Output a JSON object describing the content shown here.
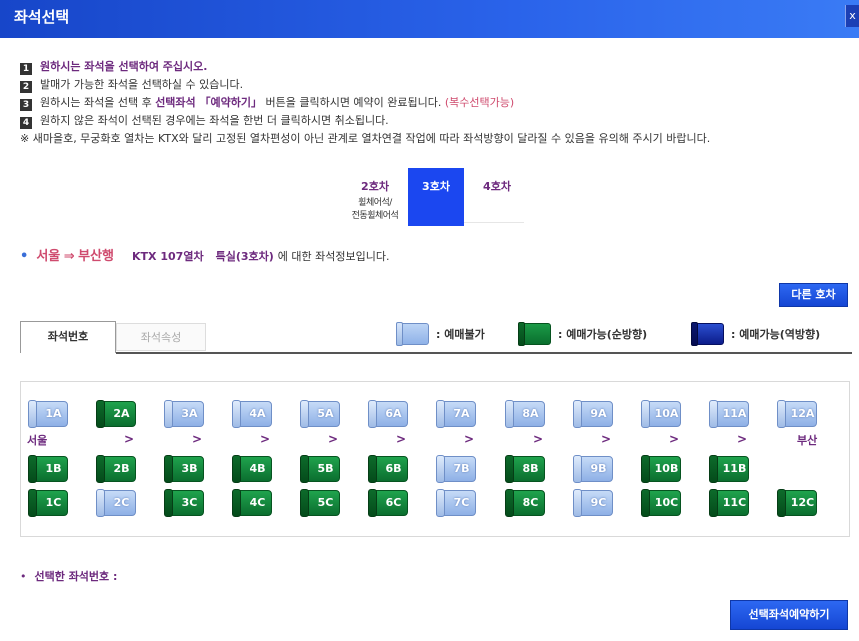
{
  "window": {
    "title": "좌석선택",
    "close_label": "x"
  },
  "instructions": [
    {
      "num": "1",
      "text": "원하시는 좌석을 선택하여 주십시오.",
      "style": "purple"
    },
    {
      "num": "2",
      "text": "발매가 가능한 좌석을 선택하실 수 있습니다.",
      "style": "plain"
    },
    {
      "num": "3",
      "text_a": "원하시는 좌석을 선택 후 ",
      "text_b": "선택좌석 「예약하기」",
      "text_c": " 버튼을 클릭하시면 예약이 완료됩니다. ",
      "text_d": "(복수선택가능)"
    },
    {
      "num": "4",
      "text": "원하지 않은 좌석이 선택된 경우에는 좌석을 한번 더 클릭하시면 취소됩니다.",
      "style": "plain"
    }
  ],
  "warning": "※ 새마을호, 무궁화호 열차는 KTX와 달리 고정된 열차편성이 아닌 관계로 열차연결 작업에 따라 좌석방향이 달라질 수 있음을 유의해 주시기 바랍니다.",
  "car_tabs": [
    {
      "label": "2호차",
      "sub1": "휠체어석/",
      "sub2": "전동휠체어석",
      "active": false
    },
    {
      "label": "3호차",
      "active": true
    },
    {
      "label": "4호차",
      "active": false
    }
  ],
  "route": {
    "bullet": "•",
    "from": "서울",
    "arrow": "⇒",
    "to": "부산행",
    "train": "KTX 107열차",
    "car_class": "특실(3호차)",
    "suffix": "에 대한 좌석정보입니다."
  },
  "next_car_button": "다른 호차",
  "info_tabs": [
    {
      "label": "좌석번호",
      "active": true
    },
    {
      "label": "좌석속성",
      "active": false
    }
  ],
  "legend": [
    {
      "icon": "seat-unavailable-icon",
      "color": "#9ebbe6",
      "label": ": 예매불가"
    },
    {
      "icon": "seat-forward-icon",
      "color": "#0b6e2f",
      "label": ": 예매가능(순방향)"
    },
    {
      "icon": "seat-reverse-icon",
      "color": "#0c1c8a",
      "label": ": 예매가능(역방향)"
    }
  ],
  "seat_rows": [
    {
      "row": "A",
      "seats": [
        {
          "id": "1A",
          "status": "unavailable"
        },
        {
          "id": "2A",
          "status": "available"
        },
        {
          "id": "3A",
          "status": "unavailable"
        },
        {
          "id": "4A",
          "status": "unavailable"
        },
        {
          "id": "5A",
          "status": "unavailable"
        },
        {
          "id": "6A",
          "status": "unavailable"
        },
        {
          "id": "7A",
          "status": "unavailable"
        },
        {
          "id": "8A",
          "status": "unavailable"
        },
        {
          "id": "9A",
          "status": "unavailable"
        },
        {
          "id": "10A",
          "status": "unavailable"
        },
        {
          "id": "11A",
          "status": "unavailable"
        },
        {
          "id": "12A",
          "status": "unavailable"
        }
      ]
    },
    {
      "row": "B",
      "seats": [
        {
          "id": "1B",
          "status": "available"
        },
        {
          "id": "2B",
          "status": "available"
        },
        {
          "id": "3B",
          "status": "available"
        },
        {
          "id": "4B",
          "status": "available"
        },
        {
          "id": "5B",
          "status": "available"
        },
        {
          "id": "6B",
          "status": "available"
        },
        {
          "id": "7B",
          "status": "unavailable"
        },
        {
          "id": "8B",
          "status": "available"
        },
        {
          "id": "9B",
          "status": "unavailable"
        },
        {
          "id": "10B",
          "status": "available"
        },
        {
          "id": "11B",
          "status": "available"
        }
      ]
    },
    {
      "row": "C",
      "seats": [
        {
          "id": "1C",
          "status": "available"
        },
        {
          "id": "2C",
          "status": "unavailable"
        },
        {
          "id": "3C",
          "status": "available"
        },
        {
          "id": "4C",
          "status": "available"
        },
        {
          "id": "5C",
          "status": "available"
        },
        {
          "id": "6C",
          "status": "available"
        },
        {
          "id": "7C",
          "status": "unavailable"
        },
        {
          "id": "8C",
          "status": "available"
        },
        {
          "id": "9C",
          "status": "unavailable"
        },
        {
          "id": "10C",
          "status": "available"
        },
        {
          "id": "11C",
          "status": "available"
        },
        {
          "id": "12C",
          "status": "available"
        }
      ]
    }
  ],
  "direction_row": {
    "start": "서울",
    "end": "부산",
    "arrow": ">"
  },
  "selected_seats": {
    "bullet": "•",
    "label": "선택한 좌석번호 :"
  },
  "reserve_button": "선택좌석예약하기"
}
